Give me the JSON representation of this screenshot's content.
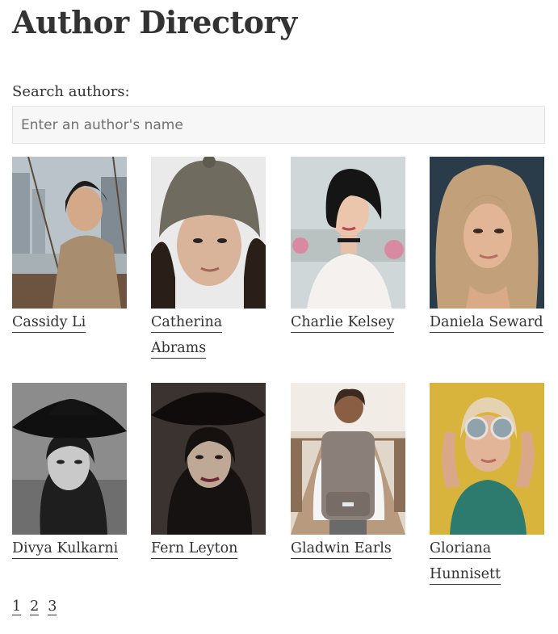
{
  "header": {
    "title": "Author Directory"
  },
  "search": {
    "label": "Search authors:",
    "placeholder": "Enter an author's name",
    "value": ""
  },
  "authors": [
    {
      "name": "Cassidy Li",
      "photo": "portrait-photo"
    },
    {
      "name": "Catherina Abrams",
      "photo": "portrait-photo"
    },
    {
      "name": "Charlie Kelsey",
      "photo": "portrait-photo"
    },
    {
      "name": "Daniela Seward",
      "photo": "portrait-photo"
    },
    {
      "name": "Divya Kulkarni",
      "photo": "portrait-photo"
    },
    {
      "name": "Fern Leyton",
      "photo": "portrait-photo"
    },
    {
      "name": "Gladwin Earls",
      "photo": "portrait-photo"
    },
    {
      "name": "Gloriana Hunnisett",
      "photo": "portrait-photo"
    }
  ],
  "pagination": {
    "pages": [
      "1",
      "2",
      "3"
    ]
  },
  "colors": {
    "text": "#333333",
    "input_bg": "#f7f7f7",
    "input_border": "#e2e2e2"
  }
}
